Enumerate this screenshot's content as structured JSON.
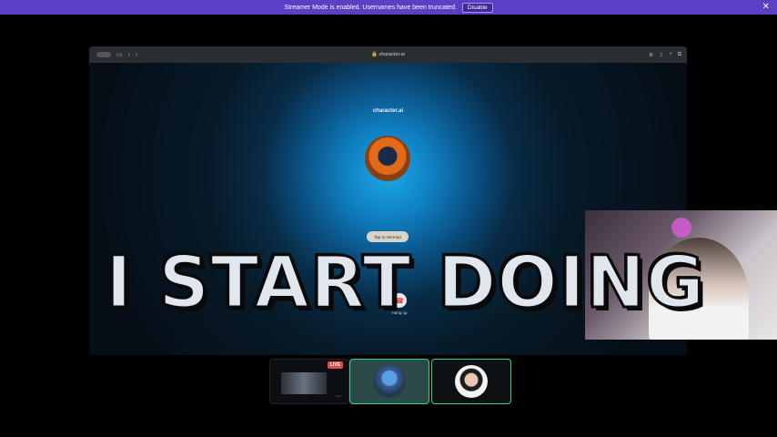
{
  "banner": {
    "message": "Streamer Mode is enabled. Usernames have been truncated.",
    "disable_label": "Disable",
    "close_glyph": "✕"
  },
  "browser": {
    "url": "character.ai"
  },
  "call": {
    "brand": "character.ai",
    "interrupt_label": "Tap to interrupt",
    "hangup_label": "Hang up"
  },
  "caption": {
    "text": "I START DOING"
  },
  "participants": {
    "live_badge": "LIVE",
    "more_glyph": "···"
  },
  "colors": {
    "banner_bg": "#5b3fc4",
    "active_border": "#35d28c",
    "live_badge": "#e5484d"
  }
}
